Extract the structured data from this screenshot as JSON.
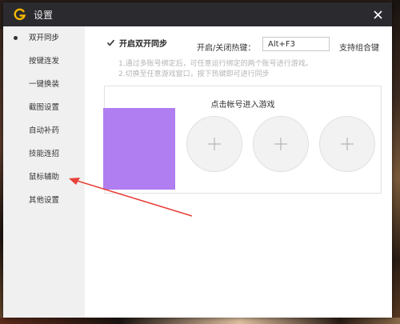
{
  "window": {
    "title": "设置",
    "logo_icon": "game-logo-icon",
    "close_icon": "close-icon"
  },
  "sidebar": {
    "items": [
      {
        "label": "双开同步",
        "active": true
      },
      {
        "label": "按键连发"
      },
      {
        "label": "一键换装"
      },
      {
        "label": "截图设置"
      },
      {
        "label": "自动补药"
      },
      {
        "label": "技能连招"
      },
      {
        "label": "鼠标辅助"
      },
      {
        "label": "其他设置"
      }
    ]
  },
  "sync": {
    "enable_label": "开启双开同步",
    "enabled": true,
    "hotkey_label": "开启/关闭热键：",
    "hotkey_value": "Alt+F3",
    "combo_label": "支持组合键",
    "hint1": "1.通过多账号绑定后，可任意运行绑定的两个账号进行游戏。",
    "hint2": "2.切换至任意游戏窗口，按下热键即可进行同步"
  },
  "accounts": {
    "title": "点击帐号进入游戏",
    "slots": [
      {
        "state": "filled",
        "color": "#b07ef0"
      },
      {
        "state": "empty",
        "icon": "plus-icon"
      },
      {
        "state": "empty",
        "icon": "plus-icon"
      },
      {
        "state": "empty",
        "icon": "plus-icon"
      }
    ]
  },
  "colors": {
    "titlebar": "#2b2b2f",
    "logo_accent": "#f5b800",
    "sidebar_bg": "#f0f0f0",
    "annotation_arrow": "#e8413a"
  }
}
